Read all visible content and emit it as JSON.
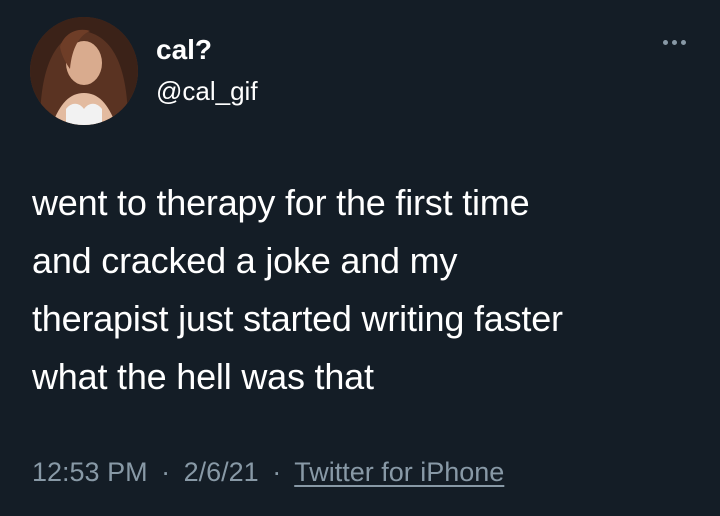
{
  "tweet": {
    "display_name": "cal?",
    "handle": "@cal_gif",
    "body_lines": [
      "went to therapy for the first time",
      "and cracked a joke and my",
      "therapist just started writing faster",
      "what the hell was that"
    ],
    "time": "12:53 PM",
    "date": "2/6/21",
    "separator": "·",
    "source": "Twitter for iPhone",
    "more_icon": "more-horizontal-icon"
  },
  "colors": {
    "background": "#141d26",
    "text": "#ffffff",
    "muted": "#8899a6"
  }
}
